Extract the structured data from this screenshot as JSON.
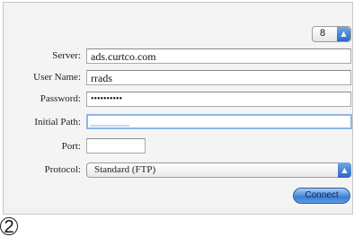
{
  "stepper": {
    "value": "8",
    "arrows_icon": "up-down-arrows-icon"
  },
  "labels": {
    "server": "Server:",
    "user_name": "User Name:",
    "password": "Password:",
    "initial_path": "Initial Path:",
    "port": "Port:",
    "protocol": "Protocol:"
  },
  "fields": {
    "server": "ads.curtco.com",
    "user_name": "rrads",
    "password": "••••••••••",
    "initial_path": "",
    "port": ""
  },
  "protocol": {
    "selected": "Standard (FTP)"
  },
  "buttons": {
    "connect": "Connect"
  },
  "step_marker": "2"
}
